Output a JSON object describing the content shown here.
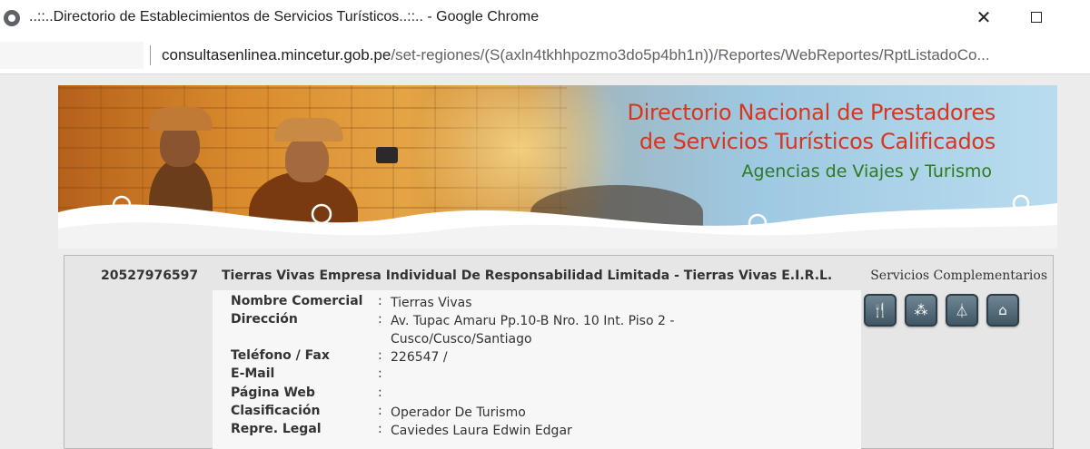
{
  "window": {
    "title": "..::..Directorio de Establecimientos de Servicios Turísticos..::.. - Google Chrome",
    "minimize_glyph": "✕",
    "maximize_label": ""
  },
  "address_bar": {
    "host": "consultasenlinea.mincetur.gob.pe",
    "path": "/set-regiones/(S(axln4tkhhpozmo3do5p4bh1n))/Reportes/WebReportes/RptListadoCo..."
  },
  "banner": {
    "title_line1": "Directorio Nacional de Prestadores",
    "title_line2": "de Servicios Turísticos Calificados",
    "subtitle": "Agencias de Viajes y Turismo",
    "colors": {
      "title": "#d8351e",
      "subtitle": "#2e7a1d"
    }
  },
  "record": {
    "ruc": "20527976597",
    "razon_social": "Tierras Vivas Empresa Individual De Responsabilidad Limitada - Tierras Vivas E.I.R.L.",
    "servicios_label": "Servicios Complementarios",
    "fields": [
      {
        "label": "Nombre Comercial",
        "value": "Tierras Vivas"
      },
      {
        "label": "Dirección",
        "value": "Av. Tupac Amaru Pp.10-B Nro. 10 Int. Piso 2 - Cusco/Cusco/Santiago"
      },
      {
        "label": "Teléfono / Fax",
        "value": "226547 /"
      },
      {
        "label": "E-Mail",
        "value": ""
      },
      {
        "label": "Página Web",
        "value": ""
      },
      {
        "label": "Clasificación",
        "value": "Operador De Turismo"
      },
      {
        "label": "Repre. Legal",
        "value": "Caviedes Laura Edwin Edgar"
      }
    ],
    "service_icons": [
      "restaurant-icon",
      "group-icon",
      "glass-icon",
      "home-icon"
    ]
  }
}
